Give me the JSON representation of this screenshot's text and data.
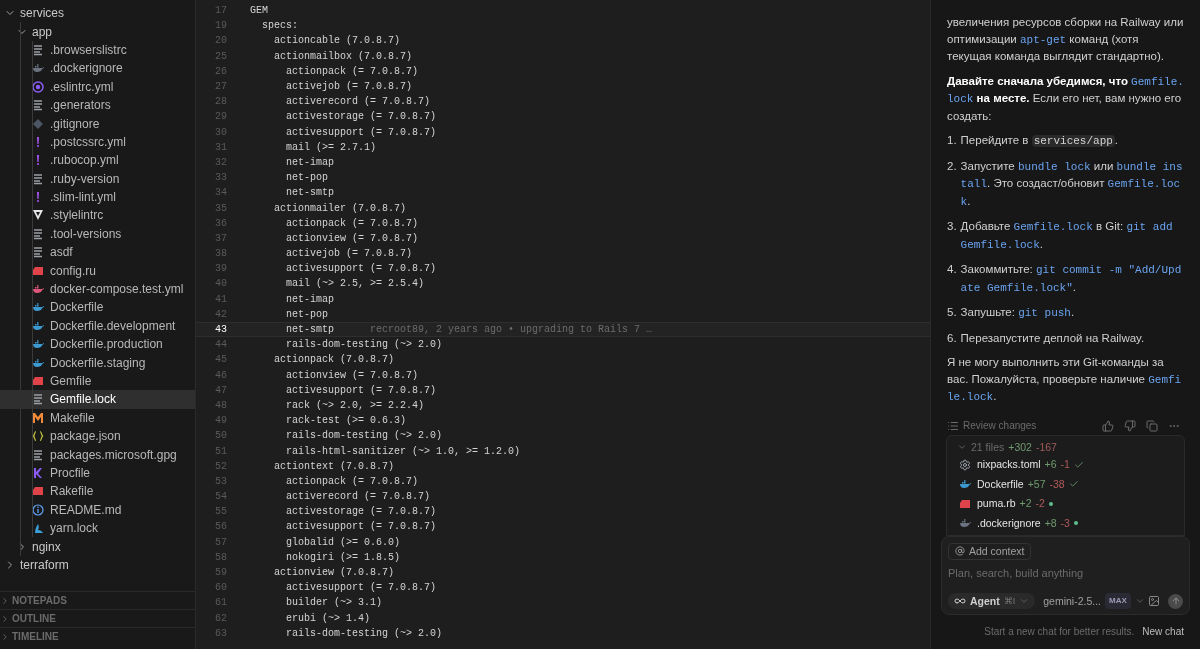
{
  "explorer": {
    "tree": [
      {
        "label": "services",
        "kind": "folder",
        "expanded": true,
        "children": [
          {
            "label": "app",
            "kind": "folder",
            "expanded": true,
            "children": [
              {
                "label": ".browserslistrc",
                "kind": "text",
                "selected": false
              },
              {
                "label": ".dockerignore",
                "kind": "dockerignore",
                "selected": false
              },
              {
                "label": ".eslintrc.yml",
                "kind": "eslint",
                "selected": false
              },
              {
                "label": ".generators",
                "kind": "text",
                "selected": false
              },
              {
                "label": ".gitignore",
                "kind": "git",
                "selected": false
              },
              {
                "label": ".postcssrc.yml",
                "kind": "yaml",
                "selected": false
              },
              {
                "label": ".rubocop.yml",
                "kind": "yaml",
                "selected": false
              },
              {
                "label": ".ruby-version",
                "kind": "text",
                "selected": false
              },
              {
                "label": ".slim-lint.yml",
                "kind": "yaml",
                "selected": false
              },
              {
                "label": ".stylelintrc",
                "kind": "stylelint",
                "selected": false
              },
              {
                "label": ".tool-versions",
                "kind": "text",
                "selected": false
              },
              {
                "label": "asdf",
                "kind": "text",
                "selected": false
              },
              {
                "label": "config.ru",
                "kind": "ruby",
                "selected": false
              },
              {
                "label": "docker-compose.test.yml",
                "kind": "compose",
                "selected": false
              },
              {
                "label": "Dockerfile",
                "kind": "docker",
                "selected": false
              },
              {
                "label": "Dockerfile.development",
                "kind": "docker",
                "selected": false
              },
              {
                "label": "Dockerfile.production",
                "kind": "docker",
                "selected": false
              },
              {
                "label": "Dockerfile.staging",
                "kind": "docker",
                "selected": false
              },
              {
                "label": "Gemfile",
                "kind": "ruby",
                "selected": false
              },
              {
                "label": "Gemfile.lock",
                "kind": "text",
                "selected": true
              },
              {
                "label": "Makefile",
                "kind": "make",
                "selected": false
              },
              {
                "label": "package.json",
                "kind": "json",
                "selected": false
              },
              {
                "label": "packages.microsoft.gpg",
                "kind": "text",
                "selected": false
              },
              {
                "label": "Procfile",
                "kind": "procfile",
                "selected": false
              },
              {
                "label": "Rakefile",
                "kind": "ruby",
                "selected": false
              },
              {
                "label": "README.md",
                "kind": "info",
                "selected": false
              },
              {
                "label": "yarn.lock",
                "kind": "yarn",
                "selected": false
              }
            ]
          },
          {
            "label": "nginx",
            "kind": "folder",
            "expanded": false
          }
        ]
      },
      {
        "label": "terraform",
        "kind": "folder",
        "expanded": false
      }
    ]
  },
  "sections": [
    {
      "label": "NOTEPADS",
      "expanded": false
    },
    {
      "label": "OUTLINE",
      "expanded": false
    },
    {
      "label": "TIMELINE",
      "expanded": false
    }
  ],
  "editor": {
    "lines": [
      {
        "number": "17",
        "text": "GEM",
        "current": false
      },
      {
        "number": "19",
        "text": "  specs:",
        "current": false
      },
      {
        "number": "20",
        "text": "    actioncable (7.0.8.7)",
        "current": false
      },
      {
        "number": "25",
        "text": "    actionmailbox (7.0.8.7)",
        "current": false
      },
      {
        "number": "26",
        "text": "      actionpack (= 7.0.8.7)",
        "current": false
      },
      {
        "number": "27",
        "text": "      activejob (= 7.0.8.7)",
        "current": false
      },
      {
        "number": "28",
        "text": "      activerecord (= 7.0.8.7)",
        "current": false
      },
      {
        "number": "29",
        "text": "      activestorage (= 7.0.8.7)",
        "current": false
      },
      {
        "number": "30",
        "text": "      activesupport (= 7.0.8.7)",
        "current": false
      },
      {
        "number": "31",
        "text": "      mail (>= 2.7.1)",
        "current": false
      },
      {
        "number": "32",
        "text": "      net-imap",
        "current": false
      },
      {
        "number": "33",
        "text": "      net-pop",
        "current": false
      },
      {
        "number": "34",
        "text": "      net-smtp",
        "current": false
      },
      {
        "number": "35",
        "text": "    actionmailer (7.0.8.7)",
        "current": false
      },
      {
        "number": "36",
        "text": "      actionpack (= 7.0.8.7)",
        "current": false
      },
      {
        "number": "37",
        "text": "      actionview (= 7.0.8.7)",
        "current": false
      },
      {
        "number": "38",
        "text": "      activejob (= 7.0.8.7)",
        "current": false
      },
      {
        "number": "39",
        "text": "      activesupport (= 7.0.8.7)",
        "current": false
      },
      {
        "number": "40",
        "text": "      mail (~> 2.5, >= 2.5.4)",
        "current": false
      },
      {
        "number": "41",
        "text": "      net-imap",
        "current": false
      },
      {
        "number": "42",
        "text": "      net-pop",
        "current": false
      },
      {
        "number": "43",
        "text": "      net-smtp",
        "current": true,
        "blame": "recroot89, 2 years ago • upgrading to Rails 7 …"
      },
      {
        "number": "44",
        "text": "      rails-dom-testing (~> 2.0)",
        "current": false
      },
      {
        "number": "45",
        "text": "    actionpack (7.0.8.7)",
        "current": false
      },
      {
        "number": "46",
        "text": "      actionview (= 7.0.8.7)",
        "current": false
      },
      {
        "number": "47",
        "text": "      activesupport (= 7.0.8.7)",
        "current": false
      },
      {
        "number": "48",
        "text": "      rack (~> 2.0, >= 2.2.4)",
        "current": false
      },
      {
        "number": "49",
        "text": "      rack-test (>= 0.6.3)",
        "current": false
      },
      {
        "number": "50",
        "text": "      rails-dom-testing (~> 2.0)",
        "current": false
      },
      {
        "number": "51",
        "text": "      rails-html-sanitizer (~> 1.0, >= 1.2.0)",
        "current": false
      },
      {
        "number": "52",
        "text": "    actiontext (7.0.8.7)",
        "current": false
      },
      {
        "number": "53",
        "text": "      actionpack (= 7.0.8.7)",
        "current": false
      },
      {
        "number": "54",
        "text": "      activerecord (= 7.0.8.7)",
        "current": false
      },
      {
        "number": "55",
        "text": "      activestorage (= 7.0.8.7)",
        "current": false
      },
      {
        "number": "56",
        "text": "      activesupport (= 7.0.8.7)",
        "current": false
      },
      {
        "number": "57",
        "text": "      globalid (>= 0.6.0)",
        "current": false
      },
      {
        "number": "58",
        "text": "      nokogiri (>= 1.8.5)",
        "current": false
      },
      {
        "number": "59",
        "text": "    actionview (7.0.8.7)",
        "current": false
      },
      {
        "number": "60",
        "text": "      activesupport (= 7.0.8.7)",
        "current": false
      },
      {
        "number": "61",
        "text": "      builder (~> 3.1)",
        "current": false
      },
      {
        "number": "62",
        "text": "      erubi (~> 1.4)",
        "current": false
      },
      {
        "number": "63",
        "text": "      rails-dom-testing (~> 2.0)",
        "current": false
      }
    ]
  },
  "chat": {
    "paragraphs": [
      [
        {
          "kind": "text",
          "text": "увеличения ресурсов сборки на Railway или оптимизации "
        },
        {
          "kind": "code",
          "text": "apt-get"
        },
        {
          "kind": "text",
          "text": " команд (хотя текущая команда выглядит стандартно)."
        }
      ],
      [
        {
          "kind": "bold",
          "text": "Давайте сначала убедимся, что "
        },
        {
          "kind": "code",
          "text": "Gemfile.lock"
        },
        {
          "kind": "bold",
          "text": " на месте."
        },
        {
          "kind": "text",
          "text": " Если его нет, вам нужно его создать:"
        }
      ]
    ],
    "steps": [
      {
        "number": "1.",
        "parts": [
          {
            "kind": "text",
            "text": "Перейдите в "
          },
          {
            "kind": "path",
            "text": "services/app"
          },
          {
            "kind": "text",
            "text": "."
          }
        ]
      },
      {
        "number": "2.",
        "parts": [
          {
            "kind": "text",
            "text": "Запустите "
          },
          {
            "kind": "code",
            "text": "bundle lock"
          },
          {
            "kind": "text",
            "text": " или "
          },
          {
            "kind": "code",
            "text": "bundle install"
          },
          {
            "kind": "text",
            "text": ". Это создаст/обновит "
          },
          {
            "kind": "code",
            "text": "Gemfile.lock"
          },
          {
            "kind": "text",
            "text": "."
          }
        ]
      },
      {
        "number": "3.",
        "parts": [
          {
            "kind": "text",
            "text": "Добавьте "
          },
          {
            "kind": "code",
            "text": "Gemfile.lock"
          },
          {
            "kind": "text",
            "text": " в Git: "
          },
          {
            "kind": "code",
            "text": "git add Gemfile.lock"
          },
          {
            "kind": "text",
            "text": "."
          }
        ]
      },
      {
        "number": "4.",
        "parts": [
          {
            "kind": "text",
            "text": "Закоммитьте: "
          },
          {
            "kind": "code",
            "text": "git commit -m \"Add/Update Gemfile.lock\""
          },
          {
            "kind": "text",
            "text": "."
          }
        ]
      },
      {
        "number": "5.",
        "parts": [
          {
            "kind": "text",
            "text": "Запушьте: "
          },
          {
            "kind": "code",
            "text": "git push"
          },
          {
            "kind": "text",
            "text": "."
          }
        ]
      },
      {
        "number": "6.",
        "parts": [
          {
            "kind": "text",
            "text": "Перезапустите деплой на Railway."
          }
        ]
      }
    ],
    "closing": [
      {
        "kind": "text",
        "text": "Я не могу выполнить эти Git-команды за вас. Пожалуйста, проверьте наличие "
      },
      {
        "kind": "code",
        "text": "Gemfile.lock"
      },
      {
        "kind": "text",
        "text": "."
      }
    ],
    "review": "Review changes",
    "changes": {
      "summary": "21 files",
      "added": "+302",
      "removed": "-167",
      "expanded": true,
      "files": [
        {
          "name": "nixpacks.toml",
          "kind": "config",
          "added": "+6",
          "removed": "-1",
          "accepted": true
        },
        {
          "name": "Dockerfile",
          "kind": "docker",
          "added": "+57",
          "removed": "-38",
          "accepted": true
        },
        {
          "name": "puma.rb",
          "kind": "ruby",
          "added": "+2",
          "removed": "-2",
          "accepted": false
        },
        {
          "name": ".dockerignore",
          "kind": "dockerignore",
          "added": "+8",
          "removed": "-3",
          "accepted": false
        }
      ]
    },
    "composer": {
      "context": "Add context",
      "placeholder": "Plan, search, build anything",
      "mode": "Agent",
      "mode_shortcut": "⌘I",
      "model": "gemini-2.5...",
      "model_badge": "MAX"
    },
    "footer": {
      "hint": "Start a new chat for better results.",
      "link": "New chat"
    }
  }
}
